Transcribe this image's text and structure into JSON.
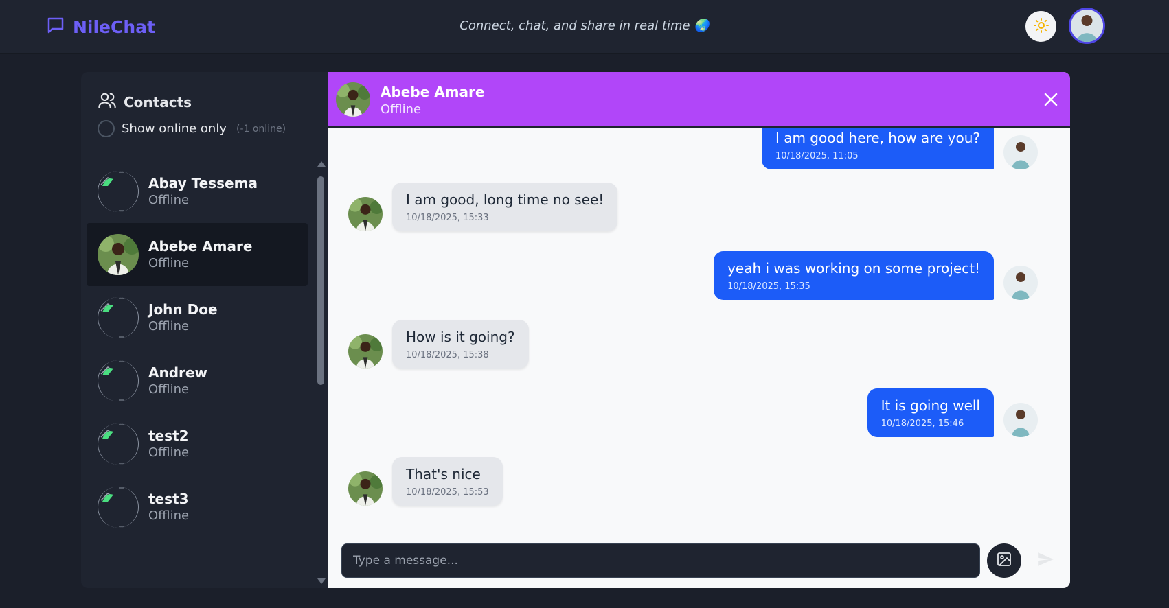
{
  "app": {
    "name": "NileChat",
    "tagline": "Connect, chat, and share in real time 🌏"
  },
  "colors": {
    "brand": "#6d5ff6",
    "chat_header": "#b146f9",
    "outgoing_bubble": "#1c5cf8",
    "incoming_bubble": "#e5e7eb"
  },
  "header": {
    "theme_toggle_icon": "sun-icon",
    "profile_avatar": "avatar"
  },
  "sidebar": {
    "title": "Contacts",
    "filter_label": "Show online only",
    "online_count": "(-1 online)",
    "contacts": [
      {
        "name": "Abay Tessema",
        "status": "Offline",
        "avatar": "broken-image"
      },
      {
        "name": "Abebe Amare",
        "status": "Offline",
        "avatar": "photo"
      },
      {
        "name": "John Doe",
        "status": "Offline",
        "avatar": "broken-image"
      },
      {
        "name": "Andrew",
        "status": "Offline",
        "avatar": "broken-image"
      },
      {
        "name": "test2",
        "status": "Offline",
        "avatar": "broken-image"
      },
      {
        "name": "test3",
        "status": "Offline",
        "avatar": "broken-image"
      }
    ]
  },
  "chat": {
    "contact_name": "Abebe Amare",
    "contact_status": "Offline",
    "messages": [
      {
        "direction": "out",
        "text": "I am good here, how are you?",
        "time": "10/18/2025, 11:05"
      },
      {
        "direction": "in",
        "text": "I am good, long time no see!",
        "time": "10/18/2025, 15:33"
      },
      {
        "direction": "out",
        "text": "yeah i was working on some project!",
        "time": "10/18/2025, 15:35"
      },
      {
        "direction": "in",
        "text": "How is it going?",
        "time": "10/18/2025, 15:38"
      },
      {
        "direction": "out",
        "text": "It is going well",
        "time": "10/18/2025, 15:46"
      },
      {
        "direction": "in",
        "text": "That's nice",
        "time": "10/18/2025, 15:53"
      }
    ],
    "input_placeholder": "Type a message..."
  }
}
